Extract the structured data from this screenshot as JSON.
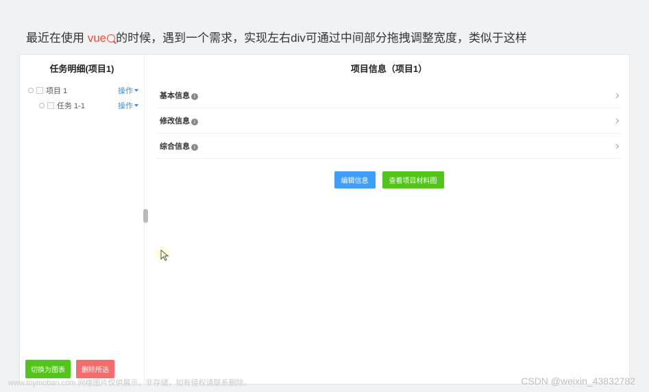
{
  "intro": {
    "prefix": "最近在使用",
    "vue": " vue",
    "suffix": "的时候，遇到一个需求，实现左右div可通过中间部分拖拽调整宽度，类似于这样"
  },
  "left": {
    "title": "任务明细(项目1)",
    "tree": {
      "parent": "项目 1",
      "child": "任务 1-1",
      "action": "操作"
    },
    "footer": {
      "switch": "切换为图表",
      "delete": "删除所选"
    }
  },
  "right": {
    "title": "项目信息（项目1）",
    "sections": {
      "basic": "基本信息",
      "modify": "修改信息",
      "summary": "综合信息"
    },
    "buttons": {
      "edit": "编辑信息",
      "material": "查看项目材料图"
    }
  },
  "watermarks": {
    "left1": "www.toymoban.com",
    "left2": " 网络图片仅供展示，非存储，如有侵权请联系删除。",
    "right": "CSDN @weixin_43832782"
  }
}
